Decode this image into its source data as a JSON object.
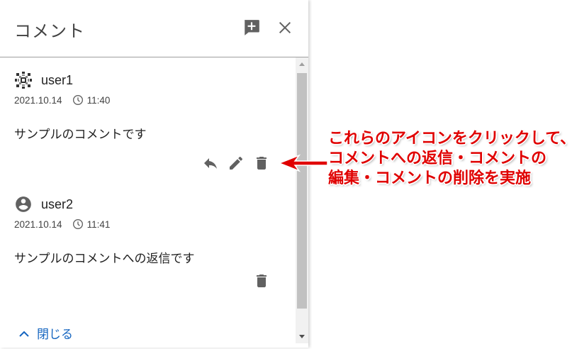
{
  "panel": {
    "title": "コメント",
    "add_icon": "add-comment-icon",
    "close_icon": "close-icon"
  },
  "comments": [
    {
      "username": "user1",
      "avatar_icon": "pattern-avatar-icon",
      "date": "2021.10.14",
      "time": "11:40",
      "text": "サンプルのコメントです",
      "actions": [
        "reply-icon",
        "edit-icon",
        "delete-icon"
      ]
    },
    {
      "username": "user2",
      "avatar_icon": "account-circle-icon",
      "date": "2021.10.14",
      "time": "11:41",
      "text": "サンプルのコメントへの返信です",
      "actions": [
        "delete-icon"
      ]
    }
  ],
  "footer": {
    "close_label": "閉じる",
    "chevron_icon": "chevron-up-icon"
  },
  "annotation": {
    "lines": [
      "これらのアイコンをクリックして、",
      "コメントへの返信・コメントの",
      "編集・コメントの削除を実施"
    ],
    "color": "#e00000"
  },
  "colors": {
    "link": "#1565c0",
    "icon": "#616161"
  }
}
